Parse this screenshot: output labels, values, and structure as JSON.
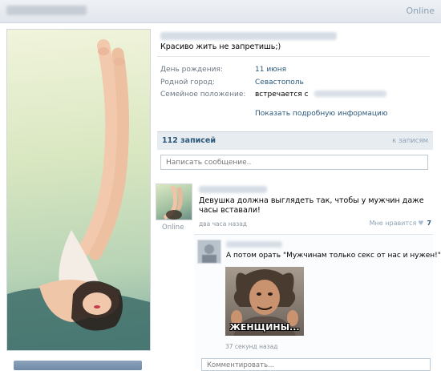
{
  "header": {
    "online_label": "Online"
  },
  "profile": {
    "status_text": "Красиво жить не запретишь;)",
    "info": [
      {
        "label": "День рождения:",
        "value": "11 июня"
      },
      {
        "label": "Родной город:",
        "value": "Севастополь"
      },
      {
        "label": "Семейное положение:",
        "value": "встречается с"
      }
    ],
    "more_link": "Показать подробную информацию"
  },
  "wall": {
    "count_label": "112 записей",
    "tab_label": "к записям",
    "compose_placeholder": "Написать сообщение..",
    "post": {
      "author_online": "Online",
      "text": "Девушка должна выглядеть так, чтобы у мужчин даже часы вставали!",
      "time": "два часа назад",
      "like_label": "Мне нравится",
      "like_count": "7",
      "reply": {
        "text": "А потом орать \"Мужчинам только секс от нас и нужен!\"",
        "meme_caption": "ЖЕНЩИНЫ...",
        "time": "37 секунд назад",
        "comment_placeholder": "Комментировать..."
      }
    }
  },
  "colors": {
    "link": "#2b587a",
    "muted": "#6b7683",
    "bar": "#e7ecf1"
  }
}
